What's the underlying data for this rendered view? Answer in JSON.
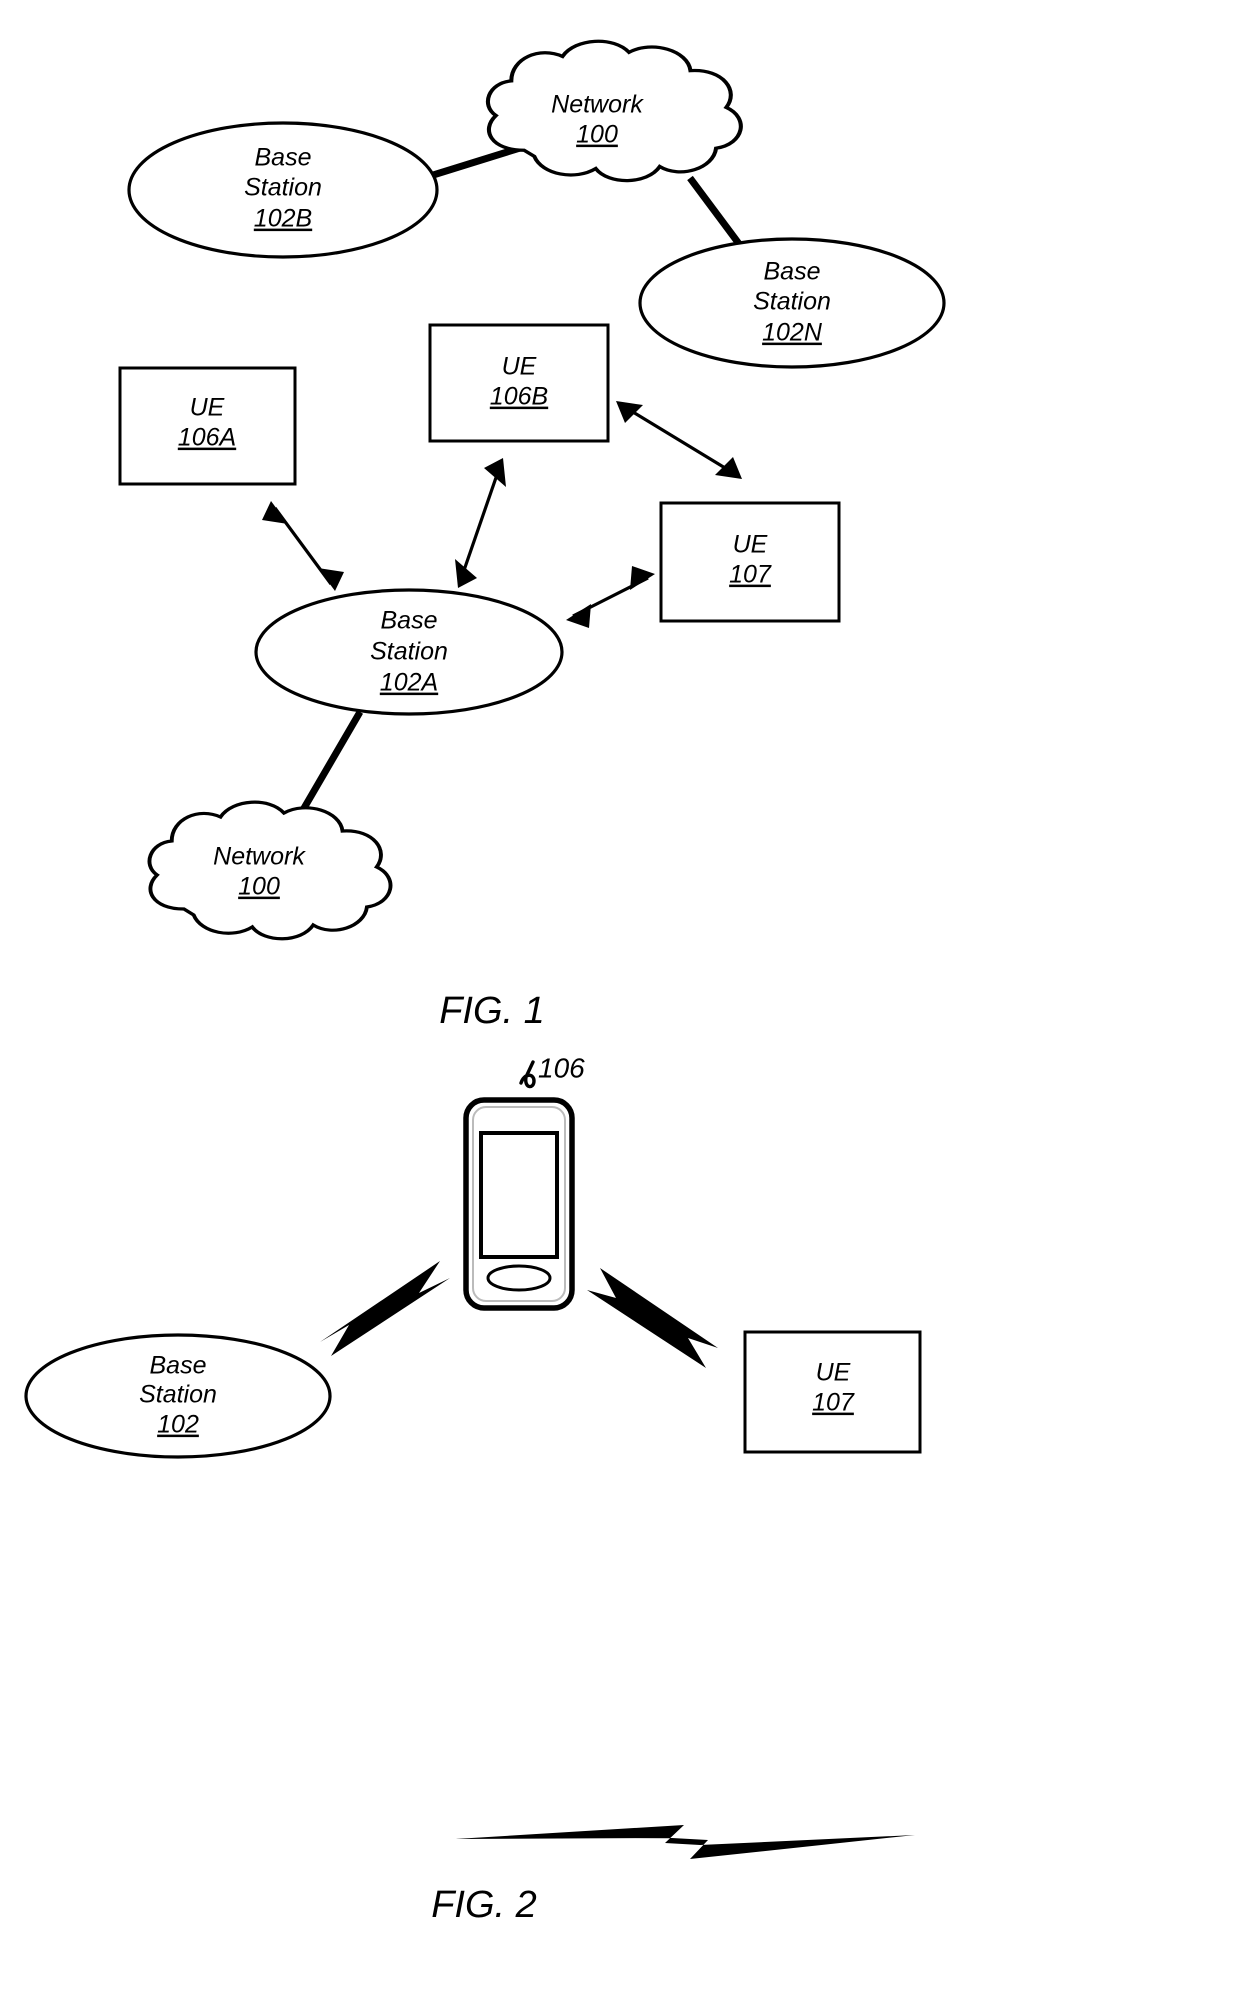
{
  "document": {
    "type": "patent-figure-sheet",
    "background_color": "#ffffff",
    "line_color": "#000000"
  },
  "figures": [
    {
      "id": "fig1",
      "caption": "FIG. 1",
      "nodes": {
        "network_top": {
          "line1": "Network",
          "ref": "100",
          "shape": "cloud"
        },
        "base_station_102b": {
          "line1": "Base",
          "line2": "Station",
          "ref": "102B",
          "shape": "ellipse"
        },
        "base_station_102n": {
          "line1": "Base",
          "line2": "Station",
          "ref": "102N",
          "shape": "ellipse"
        },
        "base_station_102a": {
          "line1": "Base",
          "line2": "Station",
          "ref": "102A",
          "shape": "ellipse"
        },
        "ue_106a": {
          "line1": "UE",
          "ref": "106A",
          "shape": "rectangle"
        },
        "ue_106b": {
          "line1": "UE",
          "ref": "106B",
          "shape": "rectangle"
        },
        "ue_107": {
          "line1": "UE",
          "ref": "107",
          "shape": "rectangle"
        },
        "network_bottom": {
          "line1": "Network",
          "ref": "100",
          "shape": "cloud"
        }
      },
      "links": [
        {
          "from": "base_station_102b",
          "to": "network_top",
          "style": "thick-line"
        },
        {
          "from": "network_top",
          "to": "base_station_102n",
          "style": "thick-line"
        },
        {
          "from": "base_station_102a",
          "to": "network_bottom",
          "style": "thick-line"
        },
        {
          "from": "base_station_102a",
          "to": "ue_106a",
          "style": "double-arrow"
        },
        {
          "from": "base_station_102a",
          "to": "ue_106b",
          "style": "double-arrow"
        },
        {
          "from": "base_station_102a",
          "to": "ue_107",
          "style": "double-arrow"
        },
        {
          "from": "ue_106b",
          "to": "ue_107",
          "style": "double-arrow"
        }
      ]
    },
    {
      "id": "fig2",
      "caption": "FIG. 2",
      "nodes": {
        "device_106": {
          "ref": "106",
          "shape": "mobile-device"
        },
        "base_station_102": {
          "line1": "Base",
          "line2": "Station",
          "ref": "102",
          "shape": "ellipse"
        },
        "ue_107": {
          "line1": "UE",
          "ref": "107",
          "shape": "rectangle"
        }
      },
      "links": [
        {
          "from": "base_station_102",
          "to": "device_106",
          "style": "lightning-bolt"
        },
        {
          "from": "device_106",
          "to": "ue_107",
          "style": "lightning-bolt"
        },
        {
          "from": "base_station_102",
          "to": "ue_107",
          "style": "lightning-bolt-flat"
        }
      ]
    }
  ]
}
